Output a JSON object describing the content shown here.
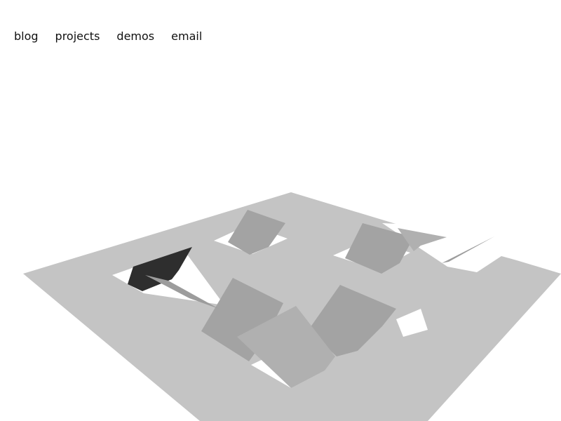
{
  "nav": {
    "items": [
      {
        "label": "blog"
      },
      {
        "label": "projects"
      },
      {
        "label": "demos"
      },
      {
        "label": "email"
      }
    ]
  },
  "scene": {
    "colors": {
      "background": "#ffffff",
      "board": "#c4c4c4",
      "hole": "#ffffff",
      "tile_light": "#b0b0b0",
      "tile_mid": "#a3a3a3",
      "tile_dark": "#2e2e2e",
      "sliver": "#9c9c9c"
    }
  }
}
